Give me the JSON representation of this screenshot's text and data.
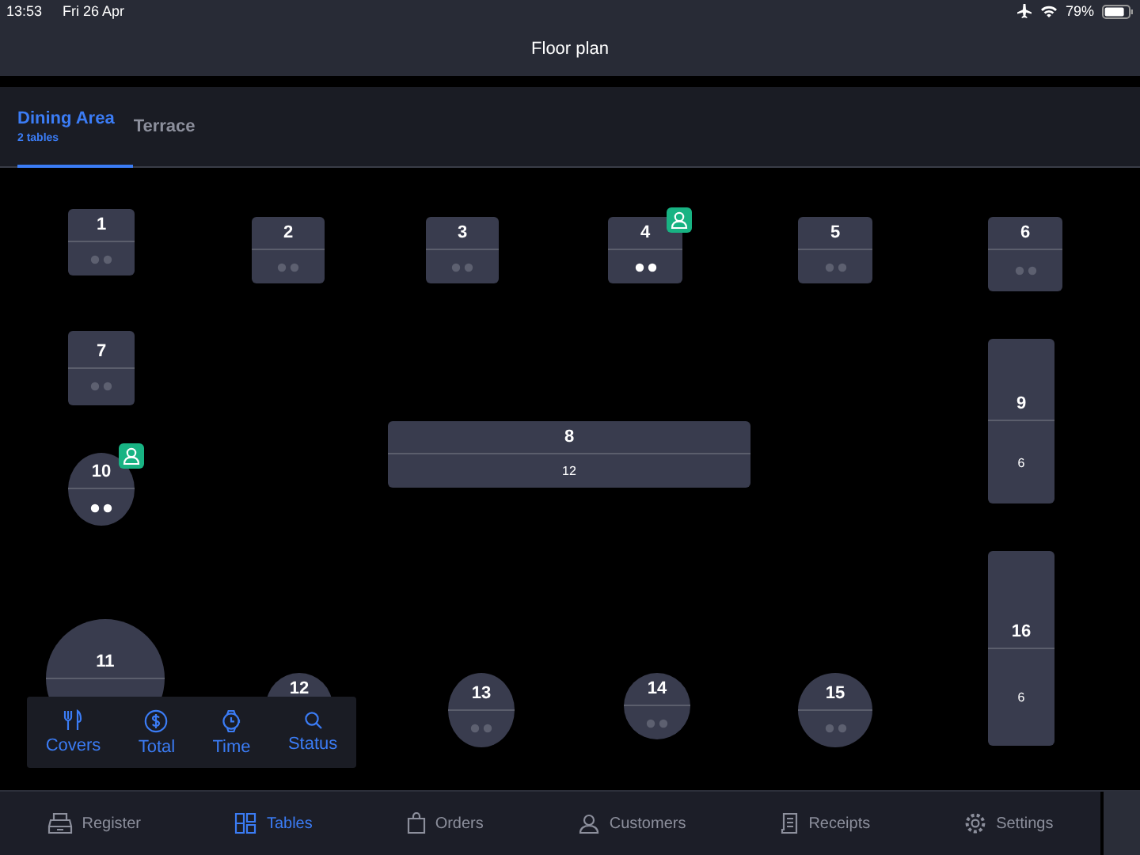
{
  "status_bar": {
    "time": "13:53",
    "date": "Fri 26 Apr",
    "battery": "79%"
  },
  "header": {
    "title": "Floor plan"
  },
  "tabs": [
    {
      "label": "Dining Area",
      "sub": "2 tables",
      "selected": true
    },
    {
      "label": "Terrace",
      "selected": false
    }
  ],
  "tables": [
    {
      "number": "1",
      "kind": "rect",
      "occupied": false,
      "dots": true
    },
    {
      "number": "2",
      "kind": "rect",
      "occupied": false,
      "dots": true
    },
    {
      "number": "3",
      "kind": "rect",
      "occupied": false,
      "dots": true
    },
    {
      "number": "4",
      "kind": "rect",
      "occupied": true,
      "dots": true
    },
    {
      "number": "5",
      "kind": "rect",
      "occupied": false,
      "dots": true
    },
    {
      "number": "6",
      "kind": "rect",
      "occupied": false,
      "dots": true
    },
    {
      "number": "7",
      "kind": "rect",
      "occupied": false,
      "dots": true
    },
    {
      "number": "8",
      "kind": "rect",
      "occupied": false,
      "dots": false,
      "seats": "12"
    },
    {
      "number": "9",
      "kind": "rect",
      "occupied": false,
      "dots": false,
      "seats": "6"
    },
    {
      "number": "10",
      "kind": "round",
      "occupied": true,
      "dots": true
    },
    {
      "number": "11",
      "kind": "round",
      "occupied": false
    },
    {
      "number": "12",
      "kind": "round",
      "occupied": false
    },
    {
      "number": "13",
      "kind": "round",
      "occupied": false,
      "dots": true
    },
    {
      "number": "14",
      "kind": "round",
      "occupied": false,
      "dots": true
    },
    {
      "number": "15",
      "kind": "round",
      "occupied": false,
      "dots": true
    },
    {
      "number": "16",
      "kind": "rect",
      "occupied": false,
      "dots": false,
      "seats": "6"
    }
  ],
  "legend": [
    {
      "kind": "covers",
      "label": "Covers"
    },
    {
      "kind": "total",
      "label": "Total"
    },
    {
      "kind": "time",
      "label": "Time"
    },
    {
      "kind": "status",
      "label": "Status"
    }
  ],
  "nav": [
    {
      "kind": "register",
      "label": "Register",
      "selected": false
    },
    {
      "kind": "tables",
      "label": "Tables",
      "selected": true
    },
    {
      "kind": "orders",
      "label": "Orders",
      "selected": false
    },
    {
      "kind": "customers",
      "label": "Customers",
      "selected": false
    },
    {
      "kind": "receipts",
      "label": "Receipts",
      "selected": false
    },
    {
      "kind": "settings",
      "label": "Settings",
      "selected": false
    }
  ]
}
